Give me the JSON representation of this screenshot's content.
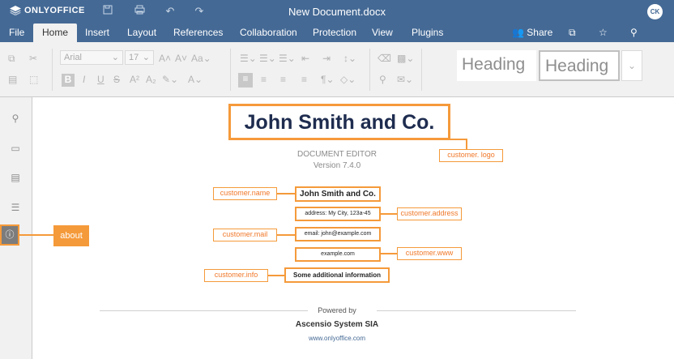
{
  "header": {
    "logo": "ONLYOFFICE",
    "doc_title": "New Document.docx",
    "avatar": "CK",
    "icons": [
      "save-icon",
      "print-icon",
      "undo-icon",
      "redo-icon"
    ]
  },
  "menu": {
    "tabs": [
      "File",
      "Home",
      "Insert",
      "Layout",
      "References",
      "Collaboration",
      "Protection",
      "View",
      "Plugins"
    ],
    "active_tab": "Home",
    "share": "Share"
  },
  "toolbar": {
    "font_name": "Arial",
    "font_size": "17",
    "style1": "Heading",
    "style2": "Heading"
  },
  "sidebar": {
    "items": [
      "search-icon",
      "comment-icon",
      "chat-icon",
      "navigation-icon",
      "about-icon"
    ]
  },
  "about": {
    "logo_text": "John Smith and Co.",
    "product": "DOCUMENT EDITOR",
    "version": "Version 7.4.0",
    "name": "John Smith and Co.",
    "address": "address: My City, 123a-45",
    "mail": "email: john@example.com",
    "www": "example.com",
    "info": "Some additional information",
    "powered_by": "Powered by",
    "company": "Ascensio System SIA",
    "site": "www.onlyoffice.com"
  },
  "callouts": {
    "logo": "customer. logo",
    "name": "customer.name",
    "address": "customer.address",
    "mail": "customer.mail",
    "www": "customer.www",
    "info": "customer.info",
    "about": "about"
  },
  "colors": {
    "header": "#446995",
    "accent": "#f59a3a",
    "title": "#1e2c4f"
  }
}
